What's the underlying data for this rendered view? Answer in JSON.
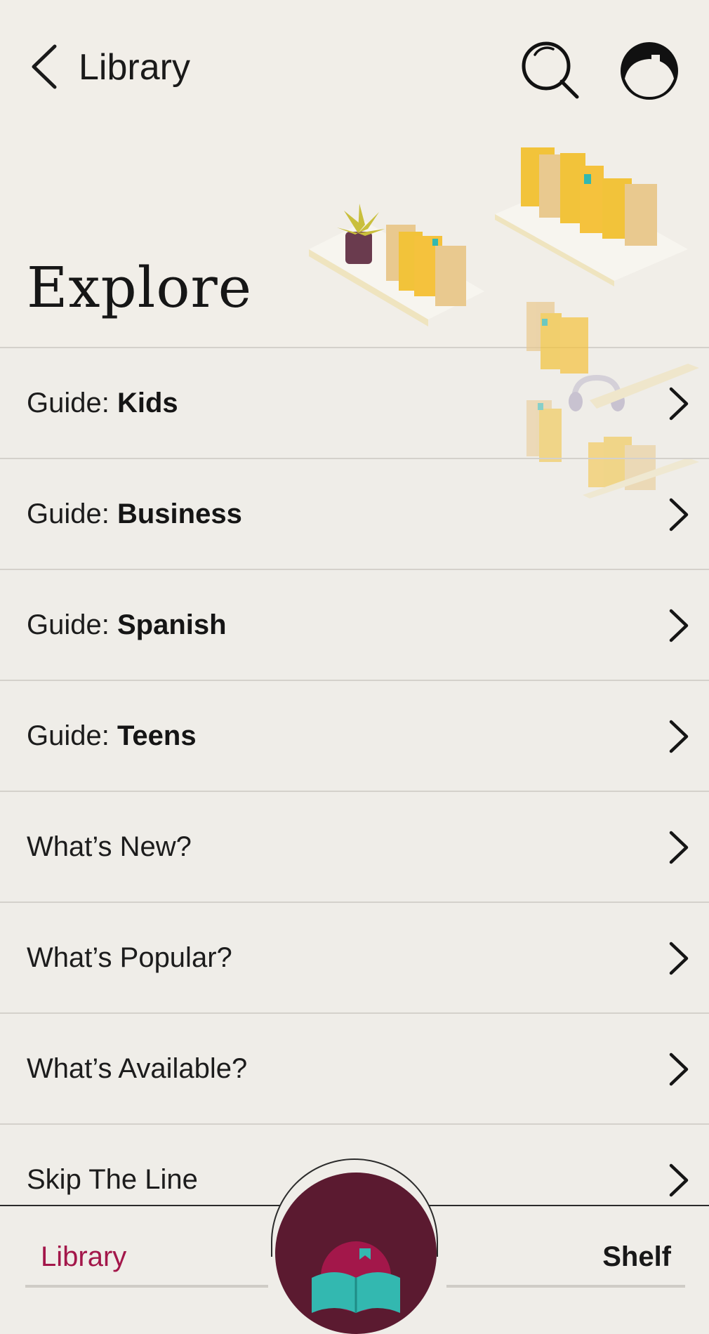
{
  "header": {
    "back_label": "Library",
    "title": "Explore",
    "icons": {
      "back": "chevron-left-icon",
      "search": "search-icon",
      "profile": "library-card-avatar-icon"
    }
  },
  "list": {
    "items": [
      {
        "prefix": "Guide: ",
        "bold": "Kids"
      },
      {
        "prefix": "Guide: ",
        "bold": "Business"
      },
      {
        "prefix": "Guide: ",
        "bold": "Spanish"
      },
      {
        "prefix": "Guide: ",
        "bold": "Teens"
      },
      {
        "prefix": "What’s New?",
        "bold": ""
      },
      {
        "prefix": "What’s Popular?",
        "bold": ""
      },
      {
        "prefix": "What’s Available?",
        "bold": ""
      },
      {
        "prefix": "Skip The Line",
        "bold": ""
      }
    ]
  },
  "nav": {
    "library_label": "Library",
    "shelf_label": "Shelf",
    "center_icon": "open-book-app-icon"
  },
  "colors": {
    "background": "#efede8",
    "accent": "#a3174a",
    "center_button": "#5b1a30",
    "book_teal": "#33b8b0",
    "book_yellow": "#f2c33a"
  }
}
